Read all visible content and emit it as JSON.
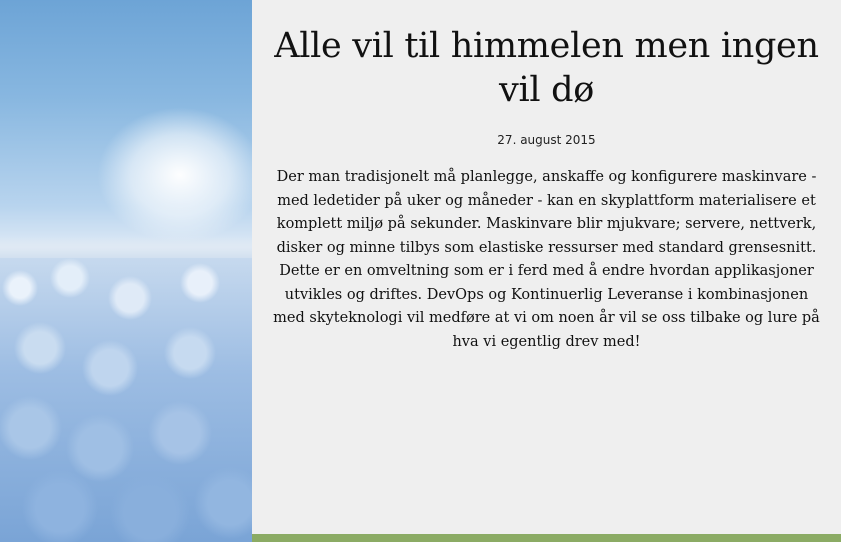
{
  "article": {
    "title": "Alle vil til himmelen men ingen vil dø",
    "date": "27. august 2015",
    "body": "Der man tradisjonelt må planlegge, anskaffe og konfigurere maskinvare - med ledetider på uker og måneder - kan en skyplattform materialisere et komplett miljø på sekunder. Maskinvare blir mjukvare; servere, nettverk, disker og minne tilbys som elastiske ressurser med standard grensesnitt. Dette er en omveltning som er i ferd med å endre hvordan applikasjoner utvikles og driftes. DevOps og Kontinuerlig Leveranse i kombinasjonen med skyteknologi vil medføre at vi om noen år vil se oss tilbake og lure på hva vi egentlig drev med!"
  },
  "colors": {
    "background": "#efefef",
    "accent_bar": "#8bab64",
    "text": "#111111"
  }
}
